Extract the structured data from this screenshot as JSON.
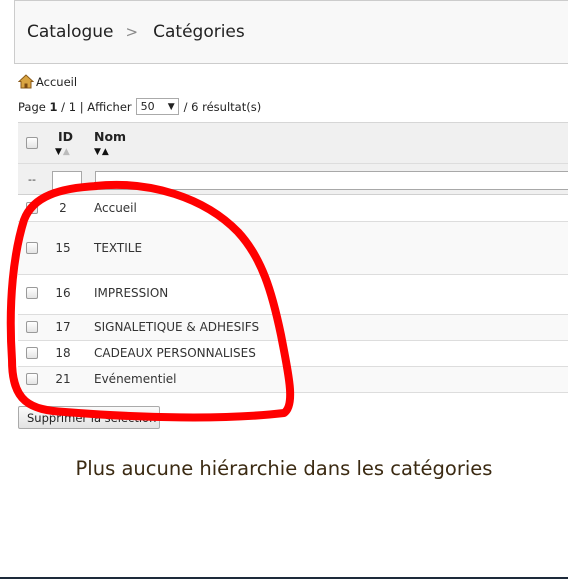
{
  "breadcrumb": {
    "items": [
      "Catalogue",
      "Catégories"
    ],
    "separator": ">"
  },
  "home_link": {
    "label": "Accueil",
    "icon": "home-icon"
  },
  "pagination": {
    "page_prefix": "Page",
    "current_page": "1",
    "page_sep": "/",
    "total_pages": "1",
    "divider": "|",
    "show_label": "Afficher",
    "per_page": "50",
    "results_text": "/ 6 résultat(s)"
  },
  "table": {
    "columns": {
      "id": "ID",
      "name": "Nom"
    },
    "filter_placeholder": "--",
    "rows": [
      {
        "id": "2",
        "name": "Accueil"
      },
      {
        "id": "15",
        "name": "TEXTILE"
      },
      {
        "id": "16",
        "name": "IMPRESSION"
      },
      {
        "id": "17",
        "name": "SIGNALETIQUE & ADHESIFS"
      },
      {
        "id": "18",
        "name": "CADEAUX PERSONNALISES"
      },
      {
        "id": "21",
        "name": "Evénementiel"
      }
    ]
  },
  "bulk_delete_button": "Supprimer la sélection",
  "annotation": {
    "text": "Plus aucune hiérarchie dans les catégories",
    "color": "#3b2a12",
    "circle_color": "#ff0000"
  }
}
